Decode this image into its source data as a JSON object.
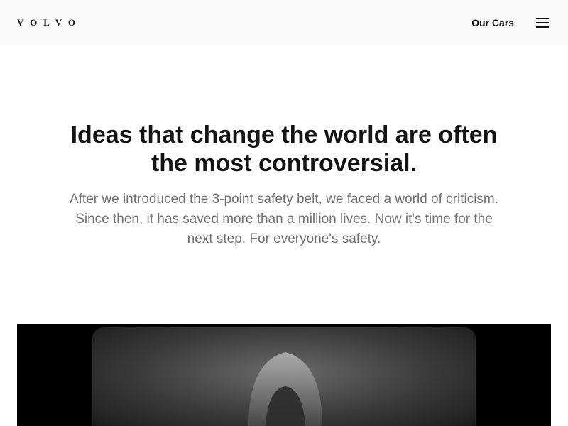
{
  "header": {
    "logo_text": "VOLVO",
    "nav_link": "Our Cars",
    "menu_icon": "hamburger-menu-icon"
  },
  "hero": {
    "headline": "Ideas that change the world are often the most controversial.",
    "subcopy": "After we introduced the 3-point safety belt, we faced a world of criticism. Since then, it has saved more than a million lives. Now it's time for the next step. For everyone's safety."
  },
  "media": {
    "type": "video-still",
    "description_icon": "video-poster-image"
  },
  "colors": {
    "header_bg": "#fafafa",
    "text": "#141414",
    "subtext": "#707070",
    "media_bg": "#000000"
  }
}
